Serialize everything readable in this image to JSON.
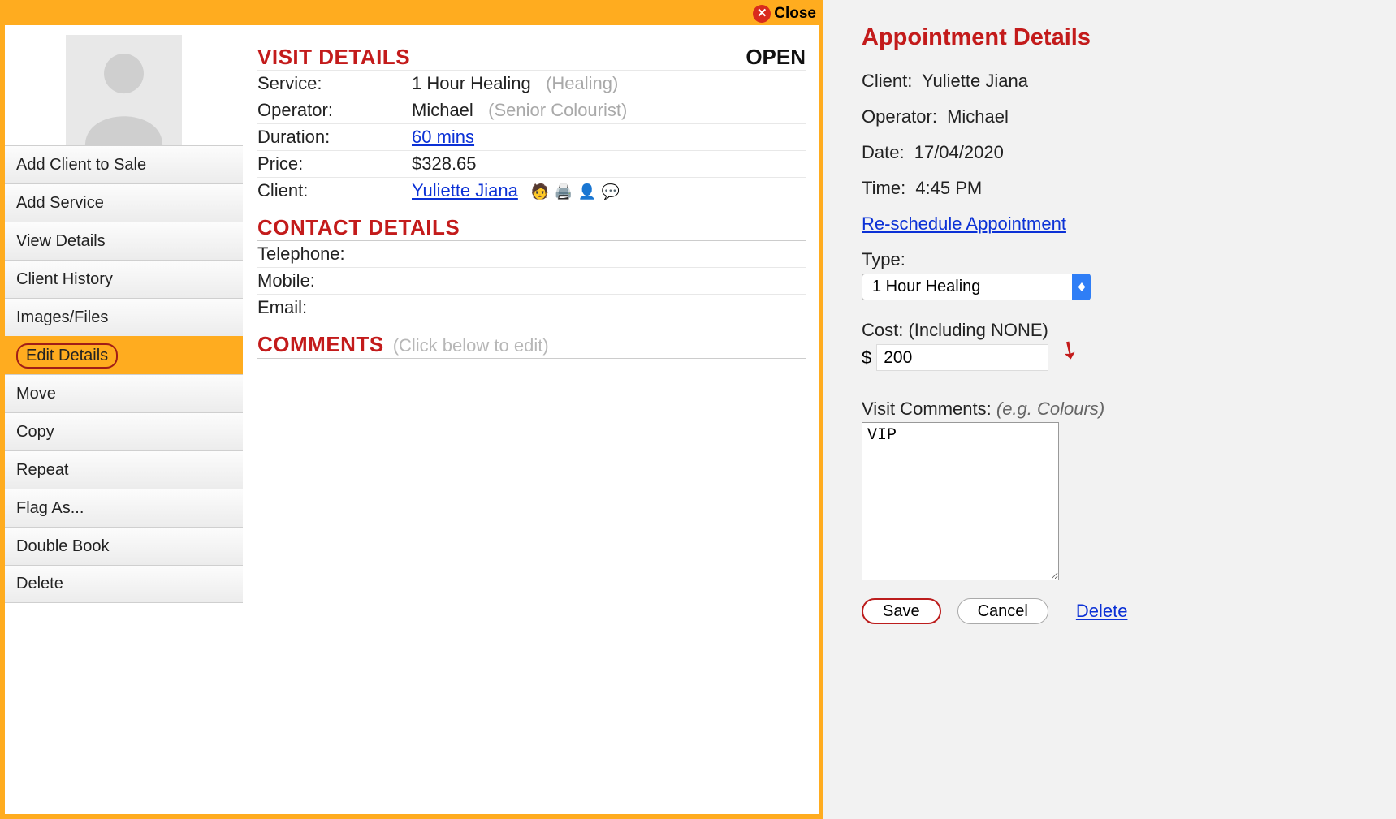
{
  "modal": {
    "close_label": "Close",
    "status": "OPEN",
    "menu": [
      {
        "label": "Add Client to Sale"
      },
      {
        "label": "Add Service"
      },
      {
        "label": "View Details"
      },
      {
        "label": "Client History"
      },
      {
        "label": "Images/Files"
      },
      {
        "label": "Edit Details",
        "selected": true
      },
      {
        "label": "Move"
      },
      {
        "label": "Copy"
      },
      {
        "label": "Repeat"
      },
      {
        "label": "Flag As..."
      },
      {
        "label": "Double Book"
      },
      {
        "label": "Delete"
      }
    ],
    "sections": {
      "visit_details": "VISIT DETAILS",
      "contact_details": "CONTACT DETAILS",
      "comments": "COMMENTS"
    },
    "visit": {
      "service_label": "Service:",
      "service_value": "1 Hour Healing",
      "service_category": "(Healing)",
      "operator_label": "Operator:",
      "operator_value": "Michael",
      "operator_role": "(Senior Colourist)",
      "duration_label": "Duration:",
      "duration_value": "60 mins",
      "price_label": "Price:",
      "price_value": "$328.65",
      "client_label": "Client:",
      "client_value": "Yuliette Jiana"
    },
    "contact": {
      "telephone_label": "Telephone:",
      "telephone_value": "",
      "mobile_label": "Mobile:",
      "mobile_value": "",
      "email_label": "Email:",
      "email_value": ""
    },
    "comments_hint": "(Click below to edit)"
  },
  "panel": {
    "title": "Appointment Details",
    "client_label": "Client:",
    "client_value": "Yuliette Jiana",
    "operator_label": "Operator:",
    "operator_value": "Michael",
    "date_label": "Date:",
    "date_value": "17/04/2020",
    "time_label": "Time:",
    "time_value": "4:45 PM",
    "reschedule_label": "Re-schedule Appointment",
    "type_label": "Type:",
    "type_value": "1 Hour Healing",
    "cost_label": "Cost: (Including NONE)",
    "cost_prefix": "$",
    "cost_value": "200",
    "comments_label": "Visit Comments:",
    "comments_hint": "(e.g. Colours)",
    "comments_value": "VIP",
    "save_label": "Save",
    "cancel_label": "Cancel",
    "delete_label": "Delete"
  }
}
